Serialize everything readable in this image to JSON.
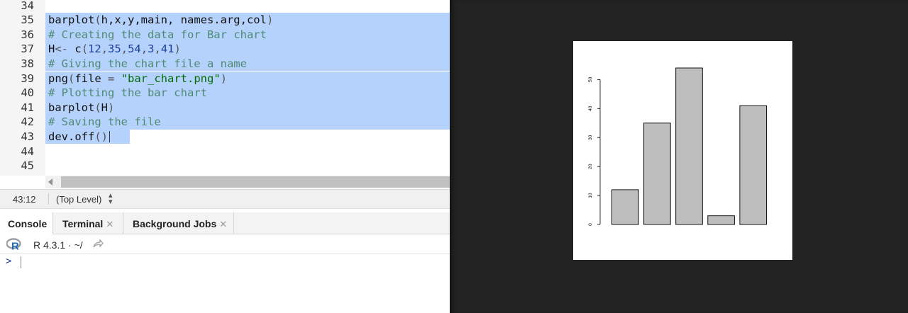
{
  "editor": {
    "lines": [
      {
        "num": "34",
        "selected": false,
        "tokens": []
      },
      {
        "num": "35",
        "selected": true,
        "tokens": [
          {
            "t": "barplot",
            "c": "ident"
          },
          {
            "t": "(",
            "c": "punct"
          },
          {
            "t": "h,x,y,main, names.arg,col",
            "c": "ident"
          },
          {
            "t": ")",
            "c": "punct"
          }
        ]
      },
      {
        "num": "36",
        "selected": true,
        "tokens": [
          {
            "t": "# Creating the data for Bar chart",
            "c": "comment"
          }
        ]
      },
      {
        "num": "37",
        "selected": true,
        "tokens": [
          {
            "t": "H",
            "c": "ident"
          },
          {
            "t": "<- ",
            "c": "op"
          },
          {
            "t": "c",
            "c": "ident"
          },
          {
            "t": "(",
            "c": "punct"
          },
          {
            "t": "12",
            "c": "number"
          },
          {
            "t": ",",
            "c": "punct"
          },
          {
            "t": "35",
            "c": "number"
          },
          {
            "t": ",",
            "c": "punct"
          },
          {
            "t": "54",
            "c": "number"
          },
          {
            "t": ",",
            "c": "punct"
          },
          {
            "t": "3",
            "c": "number"
          },
          {
            "t": ",",
            "c": "punct"
          },
          {
            "t": "41",
            "c": "number"
          },
          {
            "t": ")",
            "c": "punct"
          }
        ]
      },
      {
        "num": "38",
        "selected": true,
        "tokens": [
          {
            "t": "# Giving the chart file a name",
            "c": "comment"
          }
        ]
      },
      {
        "num": "39",
        "selected": true,
        "tokens": [
          {
            "t": "png",
            "c": "ident"
          },
          {
            "t": "(",
            "c": "punct"
          },
          {
            "t": "file ",
            "c": "ident"
          },
          {
            "t": "= ",
            "c": "op"
          },
          {
            "t": "\"bar_chart.png\"",
            "c": "string"
          },
          {
            "t": ")",
            "c": "punct"
          }
        ]
      },
      {
        "num": "40",
        "selected": true,
        "tokens": [
          {
            "t": "# Plotting the bar chart",
            "c": "comment"
          }
        ]
      },
      {
        "num": "41",
        "selected": true,
        "tokens": [
          {
            "t": "barplot",
            "c": "ident"
          },
          {
            "t": "(",
            "c": "punct"
          },
          {
            "t": "H",
            "c": "ident"
          },
          {
            "t": ")",
            "c": "punct"
          }
        ]
      },
      {
        "num": "42",
        "selected": true,
        "tokens": [
          {
            "t": "# Saving the file",
            "c": "comment"
          }
        ]
      },
      {
        "num": "43",
        "selected": "partial",
        "tokens": [
          {
            "t": "dev.off",
            "c": "ident"
          },
          {
            "t": "()",
            "c": "punct"
          }
        ]
      },
      {
        "num": "44",
        "selected": false,
        "tokens": []
      },
      {
        "num": "45",
        "selected": false,
        "tokens": []
      }
    ]
  },
  "status": {
    "cursor_position": "43:12",
    "scope": "(Top Level)",
    "scope_icon": "up-down-arrows-icon"
  },
  "console_tabs": [
    {
      "label": "Console",
      "active": true,
      "closable": false
    },
    {
      "label": "Terminal",
      "active": false,
      "closable": true
    },
    {
      "label": "Background Jobs",
      "active": false,
      "closable": true
    }
  ],
  "console": {
    "r_version": "R 4.3.1",
    "separator": "·",
    "working_dir": "~/",
    "prompt": ">",
    "r_logo_color": "#2068b6",
    "share_icon": "share-arrow-icon"
  },
  "chart_data": {
    "type": "bar",
    "categories": [
      "",
      "",
      "",
      "",
      ""
    ],
    "values": [
      12,
      35,
      54,
      3,
      41
    ],
    "ylim": [
      0,
      54
    ],
    "yticks": [
      0,
      10,
      20,
      30,
      40,
      50
    ],
    "bar_color": "#bebebe",
    "grid": false,
    "title": "",
    "xlabel": "",
    "ylabel": ""
  },
  "colors": {
    "selection": "#b4d2fb",
    "viewer_background": "#232323",
    "comment": "#4e8a74",
    "number": "#1f3f9a",
    "string": "#036a07"
  }
}
